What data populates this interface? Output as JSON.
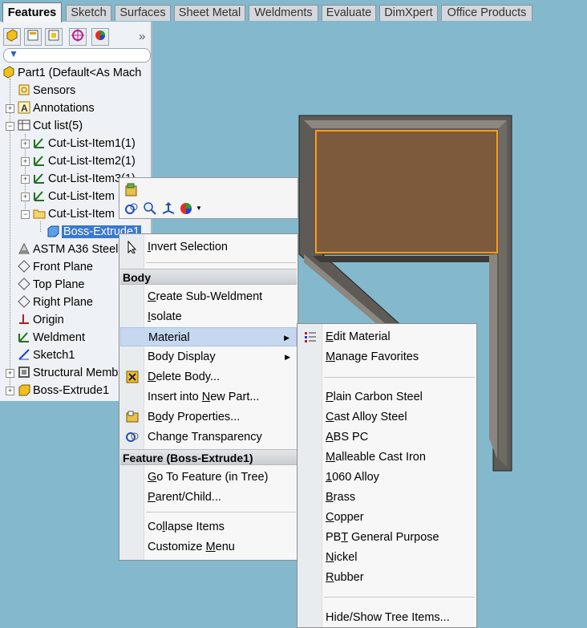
{
  "tabs": [
    {
      "label": "Features",
      "active": true
    },
    {
      "label": "Sketch"
    },
    {
      "label": "Surfaces"
    },
    {
      "label": "Sheet Metal"
    },
    {
      "label": "Weldments"
    },
    {
      "label": "Evaluate"
    },
    {
      "label": "DimXpert"
    },
    {
      "label": "Office Products"
    }
  ],
  "panel": {
    "more_glyph": "»",
    "filter_icon": "filter-icon"
  },
  "tree": {
    "part": "Part1  (Default<As Mach",
    "sensors": "Sensors",
    "annotations": "Annotations",
    "cutlist": "Cut list(5)",
    "cut1": "Cut-List-Item1(1)",
    "cut2": "Cut-List-Item2(1)",
    "cut3": "Cut-List-Item3(1)",
    "cut4": "Cut-List-Item",
    "cut5": "Cut-List-Item",
    "boss_sel": "Boss-Extrude1",
    "material": "ASTM A36 Steel",
    "front": "Front Plane",
    "top": "Top Plane",
    "right": "Right Plane",
    "origin": "Origin",
    "weldment": "Weldment",
    "sketch1": "Sketch1",
    "structural": "Structural Memb",
    "boss": "Boss-Extrude1"
  },
  "colors": {
    "viewport_bg": "#84b8cc",
    "plate_fill": "#7d5a3b",
    "frame_fill": "#5e5a55",
    "selection_orange": "#ff9a1f",
    "highlight": "#c6d8ef"
  },
  "context_menu": {
    "invert": {
      "pre": "",
      "u": "I",
      "post": "nvert Selection"
    },
    "body_header": "Body",
    "create_sub": {
      "u": "C",
      "post": "reate Sub-Weldment"
    },
    "isolate": {
      "u": "I",
      "post": "solate"
    },
    "material": "Material",
    "body_display": "Body Display",
    "delete": {
      "u": "D",
      "post": "elete Body..."
    },
    "insert_pre": "Insert into ",
    "insert_u": "N",
    "insert_post": "ew Part...",
    "props_pre": "B",
    "props_u": "o",
    "props_post": "dy Properties...",
    "transp_pre": "Chan",
    "transp_u": "g",
    "transp_post": "e Transparency",
    "feature_header": "Feature (Boss-Extrude1)",
    "goto_u": "G",
    "goto_post": "o To Feature (in Tree)",
    "parent_u": "P",
    "parent_post": "arent/Child...",
    "collapse_pre": "Co",
    "collapse_u": "l",
    "collapse_post": "lapse Items",
    "customize_pre": "Customize ",
    "customize_u": "M",
    "customize_post": "enu"
  },
  "submenu": {
    "edit_u": "E",
    "edit_post": "dit Material",
    "manage_u": "M",
    "manage_post": "anage Favorites",
    "items": [
      {
        "u": "P",
        "post": "lain Carbon Steel"
      },
      {
        "u": "C",
        "post": "ast Alloy Steel"
      },
      {
        "u": "A",
        "post": "BS PC"
      },
      {
        "u": "M",
        "post": "alleable Cast Iron"
      },
      {
        "u": "1",
        "post": "060 Alloy"
      },
      {
        "u": "B",
        "post": "rass"
      },
      {
        "u": "C",
        "post": "opper"
      },
      {
        "pre": "PB",
        "u": "T",
        "post": " General Purpose"
      },
      {
        "u": "N",
        "post": "ickel"
      },
      {
        "u": "R",
        "post": "ubber"
      }
    ],
    "hide_show": "Hide/Show Tree Items..."
  }
}
